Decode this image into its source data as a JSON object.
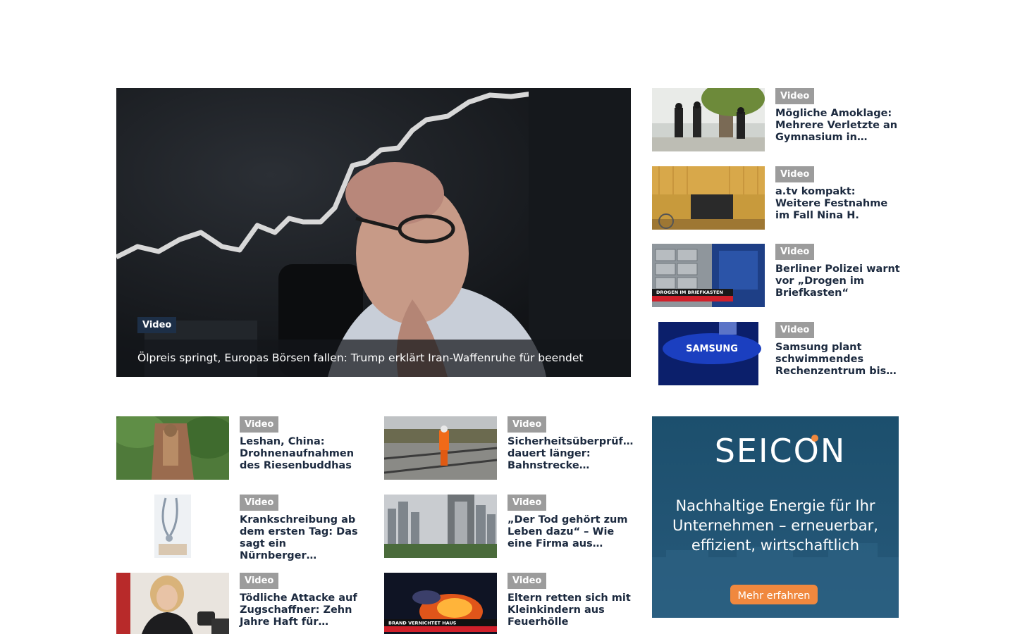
{
  "hero": {
    "badge": "Video",
    "title": "Ölpreis springt, Europas Börsen fallen: Trump erklärt Iran-Waffenruhe für beendet"
  },
  "sidebar": {
    "items": [
      {
        "badge": "Video",
        "title": "Mögliche Amoklage: Mehrere Verletzte an Gymnasium in…"
      },
      {
        "badge": "Video",
        "title": "a.tv kompakt: Weitere Festnahme im Fall Nina H."
      },
      {
        "badge": "Video",
        "title": "Berliner Polizei warnt vor „Drogen im Briefkasten“",
        "thumb_caption": "DROGEN IM BRIEFKASTEN"
      },
      {
        "badge": "Video",
        "title": "Samsung plant schwimmendes Rechenzentrum bis…",
        "thumb_logo": "SAMSUNG"
      }
    ]
  },
  "grid": {
    "items": [
      {
        "badge": "Video",
        "title": "Leshan, China: Drohnenaufnahmen des Riesenbuddhas"
      },
      {
        "badge": "Video",
        "title": "Sicherheitsüberprüf… dauert länger: Bahnstrecke…"
      },
      {
        "badge": "Video",
        "title": "Krankschreibung ab dem ersten Tag: Das sagt ein Nürnberger…"
      },
      {
        "badge": "Video",
        "title": "„Der Tod gehört zum Leben dazu“ – Wie eine Firma aus…"
      },
      {
        "badge": "Video",
        "title": "Tödliche Attacke auf Zugschaffner: Zehn Jahre Haft für…"
      },
      {
        "badge": "Video",
        "title": "Eltern retten sich mit Kleinkindern aus Feuerhölle",
        "thumb_caption": "BRAND VERNICHTET HAUS"
      }
    ]
  },
  "ad": {
    "brand": "SEICON",
    "line1": "Nachhaltige Energie für Ihr",
    "line2": "Unternehmen – erneuerbar,",
    "line3": "effizient, wirtschaftlich",
    "cta": "Mehr erfahren"
  },
  "colors": {
    "title_text": "#1c2a3f",
    "badge_grey": "#9c9c9c",
    "badge_dark": "#1d2f47",
    "ad_background": "#1f4d69",
    "ad_button": "#f0883e"
  }
}
